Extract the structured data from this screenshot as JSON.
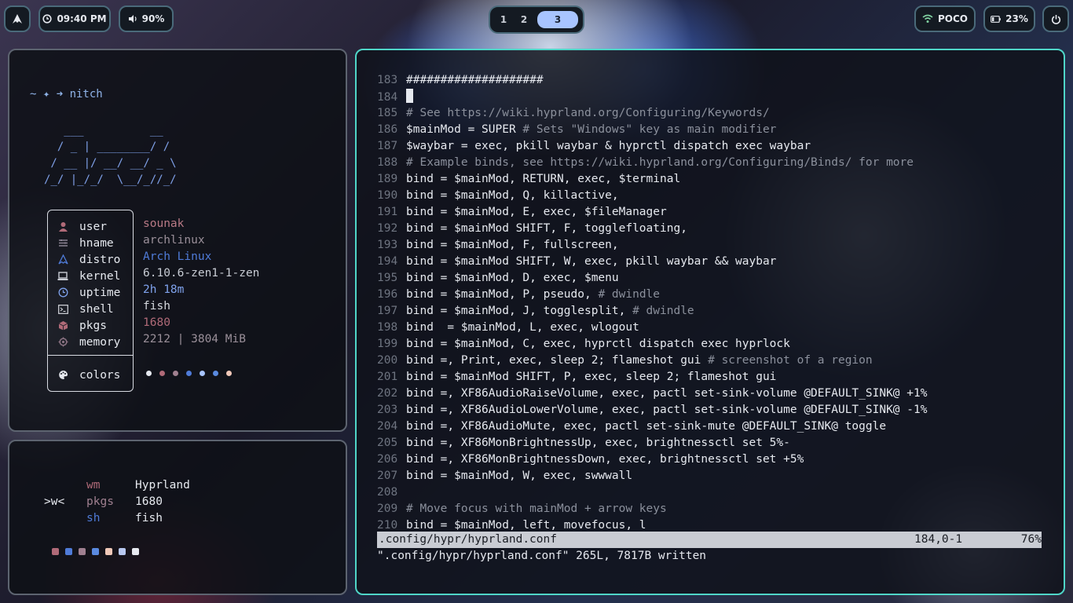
{
  "topbar": {
    "clock": "09:40 PM",
    "volume": "90%",
    "workspaces": [
      "1",
      "2",
      "3"
    ],
    "active_workspace": "3",
    "wifi": "POCO",
    "battery": "23%"
  },
  "fetch": {
    "prompt": "~ ✦ ➜ nitch",
    "ascii_lines": [
      "   ___          __",
      "  / _ | ________/ /",
      " / __ |/ __/ __/ _ \\",
      "/_/ |_/_/  \\__/_//_/"
    ],
    "rows": [
      {
        "icon": "user-icon",
        "key": "user",
        "value": "sounak",
        "color": "#b97a86"
      },
      {
        "icon": "hostname-icon",
        "key": "hname",
        "value": "archlinux",
        "color": "#9a8f99"
      },
      {
        "icon": "arch-icon",
        "key": "distro",
        "value": "Arch Linux",
        "color": "#4f7bd8"
      },
      {
        "icon": "laptop-icon",
        "key": "kernel",
        "value": "6.10.6-zen1-1-zen",
        "color": "#c8ccd4"
      },
      {
        "icon": "clock-icon",
        "key": "uptime",
        "value": "2h 18m",
        "color": "#7fa2ec"
      },
      {
        "icon": "terminal-icon",
        "key": "shell",
        "value": "fish",
        "color": "#d6d9df"
      },
      {
        "icon": "package-icon",
        "key": "pkgs",
        "value": "1680",
        "color": "#b06a78"
      },
      {
        "icon": "memory-icon",
        "key": "memory",
        "value": "2212 | 3804 MiB",
        "color": "#9a8f99"
      }
    ],
    "colors_label": "colors",
    "color_dots": [
      "#e6e9ef",
      "#b06a78",
      "#a08090",
      "#4f7bd8",
      "#a8c4ff",
      "#5a8ae0",
      "#b8c8f0",
      "#f0c8b8"
    ]
  },
  "mini": {
    "logo": ">w<",
    "rows": [
      {
        "key": "wm",
        "value": "Hyprland",
        "keycolor": "#b06a78"
      },
      {
        "key": "pkgs",
        "value": "1680",
        "keycolor": "#a08090"
      },
      {
        "key": "sh",
        "value": "fish",
        "keycolor": "#4f7bd8"
      }
    ],
    "squares": [
      "#b06a78",
      "#4f7bd8",
      "#a08090",
      "#5a8ae0",
      "#f0c8b8",
      "#b8c8f0",
      "#e6e9ef"
    ]
  },
  "editor": {
    "lines": [
      {
        "n": "183",
        "t": "####################",
        "comment": false
      },
      {
        "n": "184",
        "t": "",
        "comment": false,
        "cursor": true
      },
      {
        "n": "185",
        "t": "# See https://wiki.hyprland.org/Configuring/Keywords/",
        "comment": true
      },
      {
        "n": "186",
        "t": "$mainMod = SUPER ",
        "tc": "# Sets \"Windows\" key as main modifier"
      },
      {
        "n": "187",
        "t": "$waybar = exec, pkill waybar & hyprctl dispatch exec waybar"
      },
      {
        "n": "188",
        "t": "# Example binds, see https://wiki.hyprland.org/Configuring/Binds/ for more",
        "comment": true
      },
      {
        "n": "189",
        "t": "bind = $mainMod, RETURN, exec, $terminal"
      },
      {
        "n": "190",
        "t": "bind = $mainMod, Q, killactive,"
      },
      {
        "n": "191",
        "t": "bind = $mainMod, E, exec, $fileManager"
      },
      {
        "n": "192",
        "t": "bind = $mainMod SHIFT, F, togglefloating,"
      },
      {
        "n": "193",
        "t": "bind = $mainMod, F, fullscreen,"
      },
      {
        "n": "194",
        "t": "bind = $mainMod SHIFT, W, exec, pkill waybar && waybar"
      },
      {
        "n": "195",
        "t": "bind = $mainMod, D, exec, $menu"
      },
      {
        "n": "196",
        "t": "bind = $mainMod, P, pseudo, ",
        "tc": "# dwindle"
      },
      {
        "n": "197",
        "t": "bind = $mainMod, J, togglesplit, ",
        "tc": "# dwindle"
      },
      {
        "n": "198",
        "t": "bind  = $mainMod, L, exec, wlogout"
      },
      {
        "n": "199",
        "t": "bind = $mainMod, C, exec, hyprctl dispatch exec hyprlock"
      },
      {
        "n": "200",
        "t": "bind =, Print, exec, sleep 2; flameshot gui ",
        "tc": "# screenshot of a region"
      },
      {
        "n": "201",
        "t": "bind = $mainMod SHIFT, P, exec, sleep 2; flameshot gui"
      },
      {
        "n": "202",
        "t": "bind =, XF86AudioRaiseVolume, exec, pactl set-sink-volume @DEFAULT_SINK@ +1%"
      },
      {
        "n": "203",
        "t": "bind =, XF86AudioLowerVolume, exec, pactl set-sink-volume @DEFAULT_SINK@ -1%"
      },
      {
        "n": "204",
        "t": "bind =, XF86AudioMute, exec, pactl set-sink-mute @DEFAULT_SINK@ toggle"
      },
      {
        "n": "205",
        "t": "bind =, XF86MonBrightnessUp, exec, brightnessctl set 5%-"
      },
      {
        "n": "206",
        "t": "bind =, XF86MonBrightnessDown, exec, brightnessctl set +5%"
      },
      {
        "n": "207",
        "t": "bind = $mainMod, W, exec, swwwall"
      },
      {
        "n": "208",
        "t": ""
      },
      {
        "n": "209",
        "t": "# Move focus with mainMod + arrow keys",
        "comment": true
      },
      {
        "n": "210",
        "t": "bind = $mainMod, left, movefocus, l"
      }
    ],
    "status_file": ".config/hypr/hyprland.conf",
    "status_pos": "184,0-1",
    "status_pct": "76%",
    "message": "\".config/hypr/hyprland.conf\" 265L, 7817B written"
  }
}
